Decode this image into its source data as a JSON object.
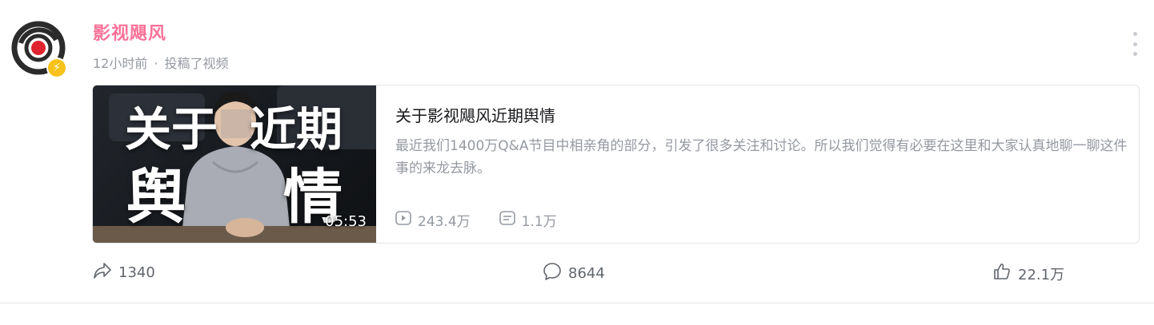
{
  "post": {
    "author": {
      "name": "影视飓风",
      "badge": "⚡",
      "name_color": "#fb7299"
    },
    "time": "12小时前",
    "separator": "·",
    "action_text": "投稿了视频"
  },
  "video": {
    "thumbnail_text_1": "关于",
    "thumbnail_text_2": "近期",
    "thumbnail_text_3": "舆",
    "thumbnail_text_4": "情",
    "duration": "05:53",
    "title": "关于影视飓风近期舆情",
    "description": "最近我们1400万Q&A节目中相亲角的部分，引发了很多关注和讨论。所以我们觉得有必要在这里和大家认真地聊一聊这件事的来龙去脉。",
    "play_count": "243.4万",
    "danmaku_count": "1.1万"
  },
  "actions": {
    "share": "1340",
    "comment": "8644",
    "like": "22.1万"
  },
  "icons": {
    "more": "more-vertical-icon",
    "play": "play-count-icon",
    "danmaku": "danmaku-icon",
    "share": "share-icon",
    "comment": "comment-icon",
    "like": "thumbs-up-icon"
  }
}
